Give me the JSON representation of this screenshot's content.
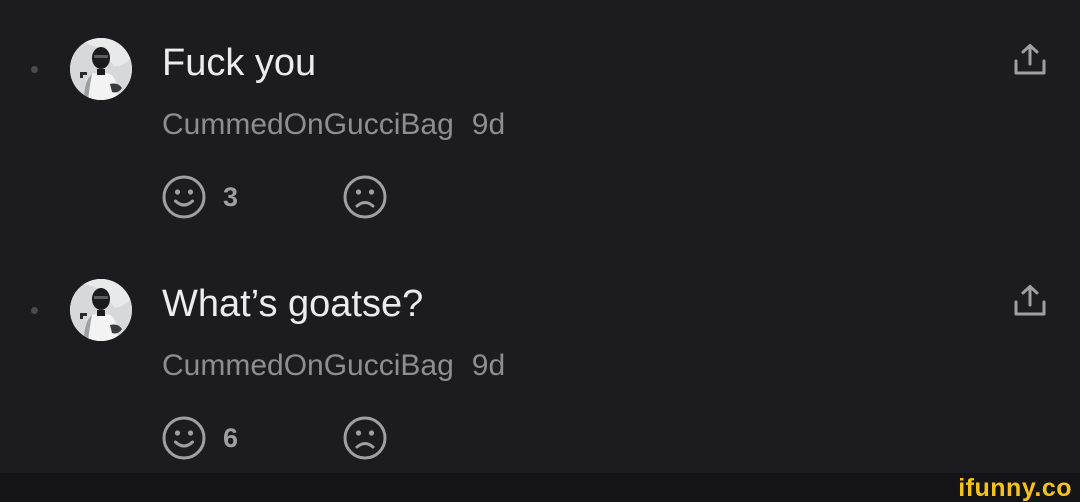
{
  "comments": [
    {
      "text": "Fuck you",
      "username": "CummedOnGucciBag",
      "age": "9d",
      "smile_count": "3",
      "avatar_icon": "masked-person-avatar",
      "share_icon": "share-icon"
    },
    {
      "text": "What’s goatse?",
      "username": "CummedOnGucciBag",
      "age": "9d",
      "smile_count": "6",
      "avatar_icon": "masked-person-avatar",
      "share_icon": "share-icon"
    }
  ],
  "watermark": "ifunny.co",
  "colors": {
    "background": "#1c1b20",
    "primary_text": "#ececef",
    "secondary_text": "#8e8d94",
    "icon": "#a09fa6",
    "watermark": "#f4c21b"
  }
}
